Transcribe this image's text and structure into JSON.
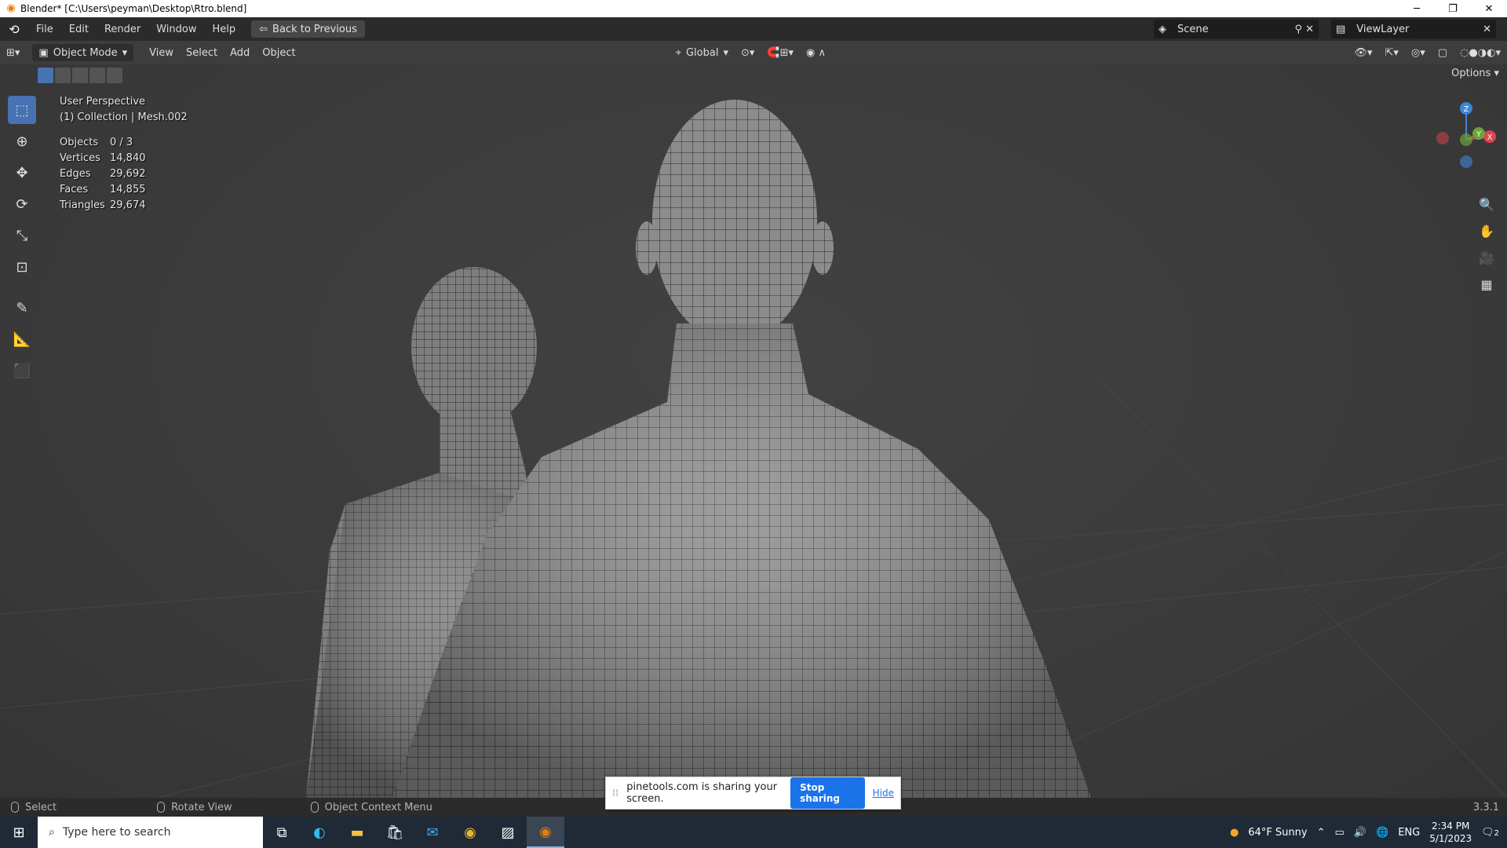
{
  "window": {
    "title": "Blender* [C:\\Users\\peyman\\Desktop\\Rtro.blend]",
    "controls": [
      "─",
      "❐",
      "✕"
    ]
  },
  "menubar": {
    "items": [
      "File",
      "Edit",
      "Render",
      "Window",
      "Help"
    ],
    "back_label": "Back to Previous",
    "scene": "Scene",
    "view_layer": "ViewLayer"
  },
  "header": {
    "mode": "Object Mode",
    "menus": [
      "View",
      "Select",
      "Add",
      "Object"
    ],
    "transform_orientation": "Global",
    "options": "Options"
  },
  "viewport": {
    "view_name": "User Perspective",
    "collection": "(1) Collection | Mesh.002",
    "stats": [
      {
        "label": "Objects",
        "value": "0 / 3"
      },
      {
        "label": "Vertices",
        "value": "14,840"
      },
      {
        "label": "Edges",
        "value": "29,692"
      },
      {
        "label": "Faces",
        "value": "14,855"
      },
      {
        "label": "Triangles",
        "value": "29,674"
      }
    ],
    "gizmo_axes": {
      "z": "Z",
      "y": "Y",
      "x": "X"
    },
    "colors": {
      "x": "#e0434e",
      "y": "#6ca33c",
      "z": "#3d86d6",
      "active_tool": "#4772b3"
    }
  },
  "tools": [
    "select-box-icon",
    "cursor-icon",
    "move-icon",
    "rotate-icon",
    "scale-icon",
    "transform-icon",
    "annotate-icon",
    "measure-icon",
    "add-cube-icon"
  ],
  "statusbar": {
    "select": "Select",
    "rotate": "Rotate View",
    "context": "Object Context Menu",
    "version": "3.3.1"
  },
  "share": {
    "message": "pinetools.com is sharing your screen.",
    "stop": "Stop sharing",
    "hide": "Hide"
  },
  "taskbar": {
    "search_placeholder": "Type here to search",
    "weather": "64°F  Sunny",
    "lang": "ENG",
    "time": "2:34 PM",
    "date": "5/1/2023",
    "notifications": "2"
  }
}
